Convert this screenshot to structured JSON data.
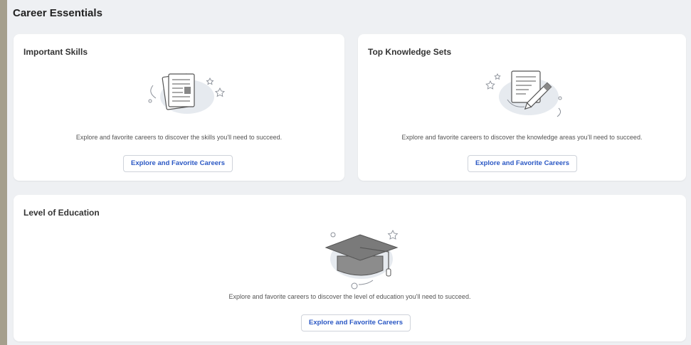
{
  "page": {
    "title": "Career Essentials"
  },
  "cards": {
    "skills": {
      "title": "Important Skills",
      "description": "Explore and favorite careers to discover the skills you'll need to succeed.",
      "button": "Explore and Favorite Careers",
      "icon": "document-icon"
    },
    "knowledge": {
      "title": "Top Knowledge Sets",
      "description": "Explore and favorite careers to discover the knowledge areas you'll need to succeed.",
      "button": "Explore and Favorite Careers",
      "icon": "pencil-document-icon"
    },
    "education": {
      "title": "Level of Education",
      "description": "Explore and favorite careers to discover the level of education you'll need to succeed.",
      "button": "Explore and Favorite Careers",
      "icon": "graduation-cap-icon"
    }
  },
  "colors": {
    "accent": "#2b58c4",
    "blob": "#e6eaef",
    "line": "#8a8f98"
  }
}
